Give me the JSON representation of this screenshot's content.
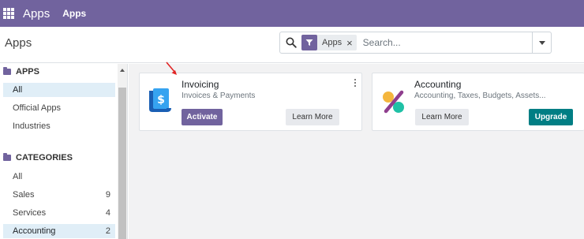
{
  "topbar": {
    "brand": "Apps",
    "menu_item": "Apps"
  },
  "control": {
    "breadcrumb": "Apps"
  },
  "search": {
    "facet_label": "Apps",
    "facet_close": "×",
    "placeholder": "Search..."
  },
  "sidebar": {
    "apps_section": "APPS",
    "apps_items": [
      {
        "label": "All"
      },
      {
        "label": "Official Apps"
      },
      {
        "label": "Industries"
      }
    ],
    "categories_section": "CATEGORIES",
    "category_items": [
      {
        "label": "All",
        "count": ""
      },
      {
        "label": "Sales",
        "count": "9"
      },
      {
        "label": "Services",
        "count": "4"
      },
      {
        "label": "Accounting",
        "count": "2"
      }
    ]
  },
  "cards": [
    {
      "name": "Invoicing",
      "summary": "Invoices & Payments",
      "primary": "Activate",
      "secondary": "Learn More"
    },
    {
      "name": "Accounting",
      "summary": "Accounting, Taxes, Budgets, Assets...",
      "primary": "Upgrade",
      "secondary": "Learn More"
    }
  ],
  "colors": {
    "brand": "#71639e",
    "active_row": "#e0eef7",
    "upgrade": "#017e84"
  }
}
